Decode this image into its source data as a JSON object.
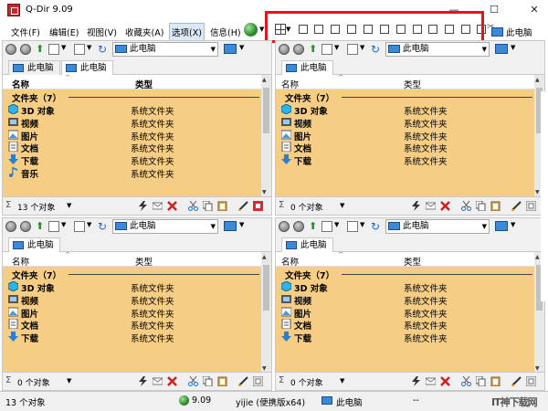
{
  "window": {
    "title": "Q-Dir 9.09",
    "minimize_glyph": "—",
    "maximize_glyph": "☐",
    "close_glyph": "✕"
  },
  "menu": {
    "items": [
      "文件(F)",
      "编辑(E)",
      "视图(V)",
      "收藏夹(A)",
      "选项(X)",
      "信息(H)"
    ],
    "active_index": 4
  },
  "top_right": {
    "location": "此电脑"
  },
  "icons": {
    "app": "q-dir-app-icon",
    "globe": "globe-icon",
    "layout": "layout-grid-icon",
    "computer": "computer-icon",
    "back": "back-arrow-icon",
    "forward": "forward-arrow-icon",
    "up": "up-folder-icon",
    "refresh": "refresh-icon"
  },
  "panes": [
    {
      "address": "此电脑",
      "tabs": [
        "此电脑",
        "此电脑"
      ],
      "selected_tab": 1,
      "columns": [
        "名称",
        "类型"
      ],
      "columns_bold": true,
      "group": "文件夹（7）",
      "rows": [
        {
          "name": "3D 对象",
          "type": "系统文件夹"
        },
        {
          "name": "视频",
          "type": "系统文件夹"
        },
        {
          "name": "图片",
          "type": "系统文件夹"
        },
        {
          "name": "文档",
          "type": "系统文件夹"
        },
        {
          "name": "下载",
          "type": "系统文件夹"
        },
        {
          "name": "音乐",
          "type": "系统文件夹"
        }
      ],
      "status_count": "13 个对象"
    },
    {
      "address": "此电脑",
      "tabs": [
        "此电脑"
      ],
      "selected_tab": 0,
      "columns": [
        "名称",
        "类型"
      ],
      "columns_bold": false,
      "group": "文件夹（7）",
      "rows": [
        {
          "name": "3D 对象",
          "type": "系统文件夹"
        },
        {
          "name": "视频",
          "type": "系统文件夹"
        },
        {
          "name": "图片",
          "type": "系统文件夹"
        },
        {
          "name": "文档",
          "type": "系统文件夹"
        },
        {
          "name": "下载",
          "type": "系统文件夹"
        }
      ],
      "status_count": "0 个对象"
    },
    {
      "address": "此电脑",
      "tabs": [
        "此电脑"
      ],
      "selected_tab": 0,
      "columns": [
        "名称",
        "类型"
      ],
      "columns_bold": false,
      "group": "文件夹（7）",
      "rows": [
        {
          "name": "3D 对象",
          "type": "系统文件夹"
        },
        {
          "name": "视频",
          "type": "系统文件夹"
        },
        {
          "name": "图片",
          "type": "系统文件夹"
        },
        {
          "name": "文档",
          "type": "系统文件夹"
        },
        {
          "name": "下载",
          "type": "系统文件夹"
        }
      ],
      "status_count": "0 个对象"
    },
    {
      "address": "此电脑",
      "tabs": [
        "此电脑"
      ],
      "selected_tab": 0,
      "columns": [
        "名称",
        "类型"
      ],
      "columns_bold": false,
      "group": "文件夹（7）",
      "rows": [
        {
          "name": "3D 对象",
          "type": "系统文件夹"
        },
        {
          "name": "视频",
          "type": "系统文件夹"
        },
        {
          "name": "图片",
          "type": "系统文件夹"
        },
        {
          "name": "文档",
          "type": "系统文件夹"
        },
        {
          "name": "下载",
          "type": "系统文件夹"
        }
      ],
      "status_count": "0 个对象"
    }
  ],
  "statusbar": {
    "count": "13 个对象",
    "version": "9.09",
    "user": "yijie (便携版x64)",
    "location": "此电脑",
    "extra": "--"
  },
  "watermark": "IT神下载网",
  "colors": {
    "list_background": "#f5cd85",
    "highlight_box": "#e8121c",
    "computer_icon": "#3a8ad6"
  }
}
